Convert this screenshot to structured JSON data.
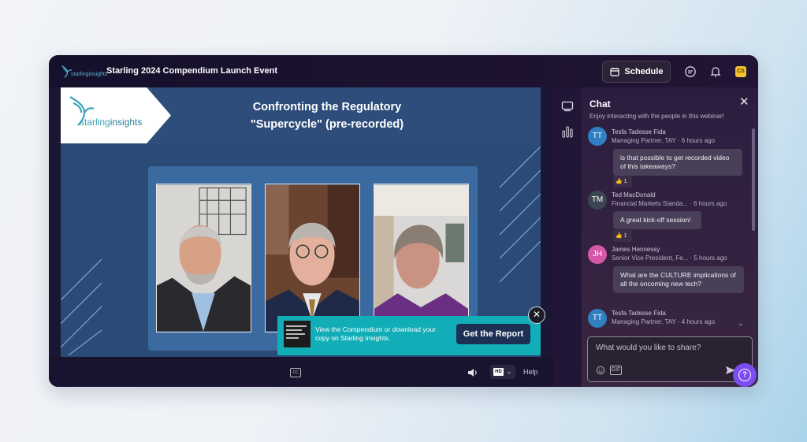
{
  "header": {
    "logo_text": "starlinginsights",
    "event_title": "Starling 2024 Compendium Launch Event",
    "schedule_label": "Schedule",
    "icons": [
      "chat-bubble-icon",
      "bell-icon",
      "profile-icon"
    ],
    "avatar_initials": "CS"
  },
  "slide": {
    "brand": "starlinginsights",
    "brand_part1": "starling",
    "brand_part2": "insights",
    "title_line1": "Confronting the Regulatory",
    "title_line2": "\"Supercycle\" (pre-recorded)"
  },
  "promo": {
    "text": "View the Compendium or download your copy on Starling Insights.",
    "button_label": "Get the Report",
    "close_symbol": "✕"
  },
  "controls": {
    "cc_label": "CC",
    "quality_label": "HD",
    "help_label": "Help"
  },
  "chat": {
    "title": "Chat",
    "subtitle": "Enjoy interacting with the people in this webinar!",
    "input_placeholder": "What would you like to share?",
    "gif_label": "GIF",
    "messages": [
      {
        "initials": "TT",
        "name": "Tesfa Tadesse Fida",
        "role": "Managing Partner, TAY",
        "time": "6 hours ago",
        "text": "is that possible to get recorded video of this takeaways?",
        "reaction": "1",
        "avatar_color": "#2f7fc1"
      },
      {
        "initials": "TM",
        "name": "Ted MacDonald",
        "role": "Financial Markets Standa...",
        "time": "6 hours ago",
        "text": "A great kick-off session!",
        "reaction": "1",
        "avatar_color": "#3b4650"
      },
      {
        "initials": "JH",
        "name": "James Hennessy",
        "role": "Senior Vice President, Fe...",
        "time": "5 hours ago",
        "text": "What are the CULTURE implications of all the oncoming new tech?",
        "reaction": "",
        "avatar_color": "#d657a8"
      },
      {
        "initials": "TT",
        "name": "Tesfa Tadesse Fida",
        "role": "Managing Partner, TAY",
        "time": "4 hours ago",
        "text": "",
        "reaction": "",
        "avatar_color": "#2f7fc1"
      }
    ]
  },
  "colors": {
    "accent": "#12aeb8",
    "button_dark": "#1d2f55",
    "help_fab": "#7b4cf2",
    "slide_bg": "#2b4a76"
  }
}
